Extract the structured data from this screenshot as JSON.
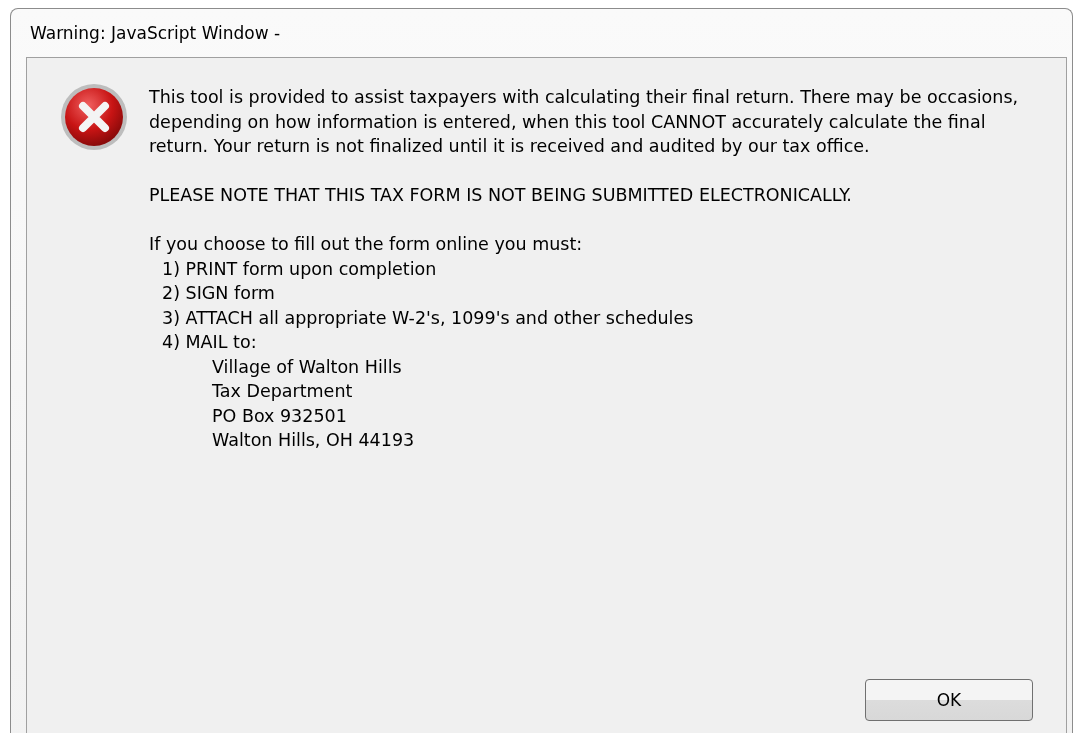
{
  "window": {
    "title": "Warning: JavaScript Window -"
  },
  "message": {
    "paragraphs": [
      "This tool is provided to assist taxpayers with calculating their final return. There may be occasions, depending on how information is entered, when this tool CANNOT accurately calculate the final return. Your return is not finalized until it is received and audited by our tax office.",
      "PLEASE NOTE THAT THIS TAX FORM IS NOT BEING SUBMITTED ELECTRONICALLY."
    ],
    "intro": "If you choose to fill out the form online you must:",
    "steps": [
      {
        "text": "1) PRINT form upon completion"
      },
      {
        "text": "2) SIGN form"
      },
      {
        "text": "3) ATTACH all appropriate W-2's, 1099's and other schedules"
      },
      {
        "text": "4) MAIL to:",
        "address": [
          "Village of Walton Hills",
          "Tax Department",
          "PO Box 932501",
          "Walton Hills, OH 44193"
        ]
      }
    ]
  },
  "buttons": [
    "OK"
  ]
}
